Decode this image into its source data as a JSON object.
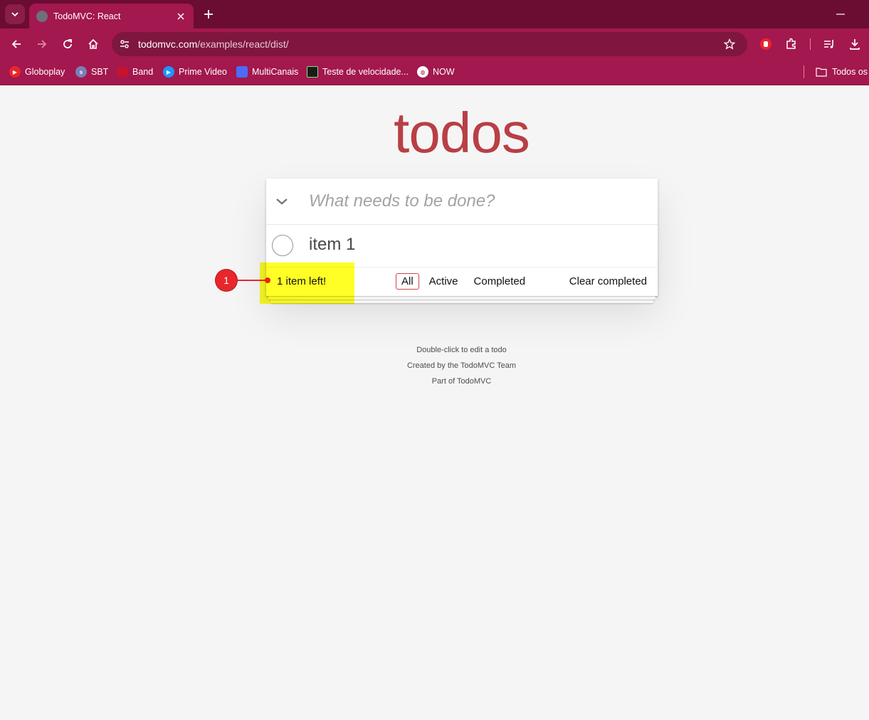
{
  "browser": {
    "tab_title": "TodoMVC: React",
    "url_host": "todomvc.com",
    "url_path": "/examples/react/dist/",
    "bookmarks": [
      {
        "label": "Globoplay",
        "icon": "globoplay-icon",
        "color": "#e8262c"
      },
      {
        "label": "SBT",
        "icon": "sbt-icon",
        "color": "#7a7fb8"
      },
      {
        "label": "Band",
        "icon": "band-icon",
        "color": "#c4122f"
      },
      {
        "label": "Prime Video",
        "icon": "prime-video-icon",
        "color": "#1a98ff"
      },
      {
        "label": "MultiCanais",
        "icon": "multicanais-icon",
        "color": "#4a6cf7"
      },
      {
        "label": "Teste de velocidade...",
        "icon": "speedtest-icon",
        "color": "#1b1b1b"
      },
      {
        "label": "NOW",
        "icon": "globe-icon",
        "color": "#ffffff"
      }
    ],
    "bookmarks_folder": "Todos os"
  },
  "app": {
    "title": "todos",
    "new_todo_placeholder": "What needs to be done?",
    "todos": [
      {
        "label": "item 1",
        "completed": false
      }
    ],
    "footer": {
      "count_text": "1 item left!",
      "filters": [
        "All",
        "Active",
        "Completed"
      ],
      "selected_filter": "All",
      "clear_label": "Clear completed"
    },
    "info": [
      "Double-click to edit a todo",
      "Created by the TodoMVC Team",
      "Part of TodoMVC"
    ]
  },
  "annotation": {
    "marker_number": "1"
  },
  "colors": {
    "chrome": "#a3184e",
    "titlebar": "#6b0c33",
    "title_red": "#b83f45",
    "highlight": "#ffff00",
    "marker": "#e8262c"
  }
}
